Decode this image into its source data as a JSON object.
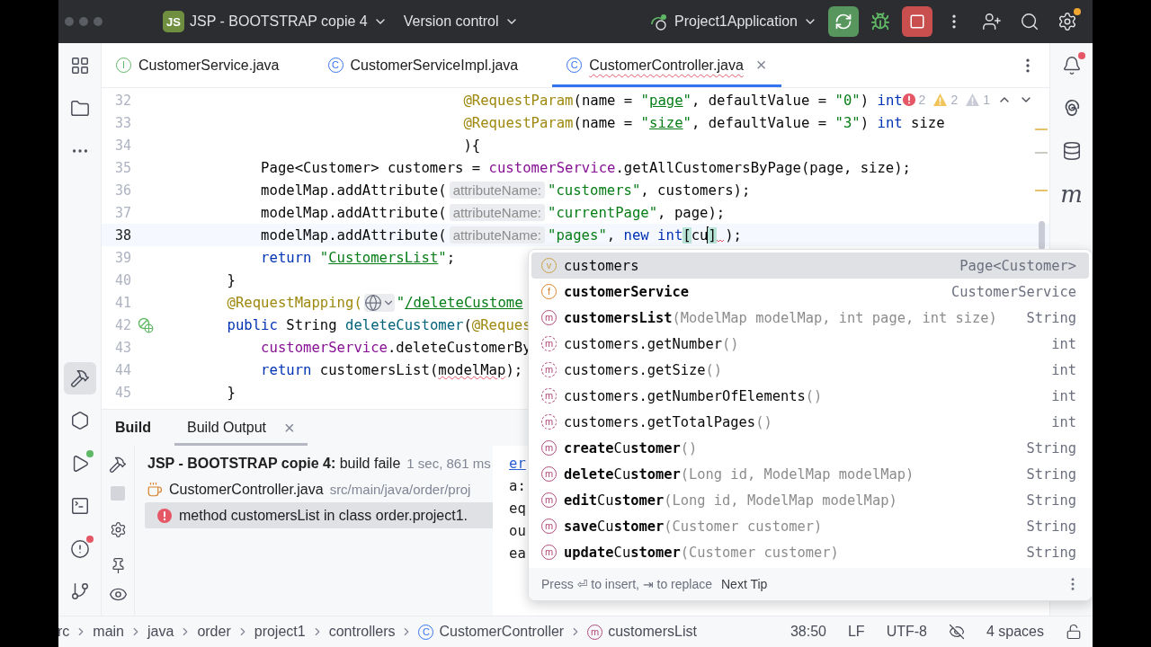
{
  "window": {
    "project_badge": "JS",
    "project": "JSP - BOOTSTRAP copie 4",
    "vcs": "Version control",
    "run_config": "Project1Application",
    "settings_has_badge": true
  },
  "left_tools_top": [
    {
      "kind": "structure",
      "selected": false
    },
    {
      "kind": "project",
      "selected": false
    },
    {
      "kind": "more",
      "selected": false
    }
  ],
  "left_tools_bottom": [
    {
      "kind": "build",
      "selected": true,
      "has_badge": false
    },
    {
      "kind": "services",
      "selected": false,
      "has_badge": false
    },
    {
      "kind": "run",
      "selected": false,
      "has_badge": true
    },
    {
      "kind": "terminal",
      "selected": false,
      "has_badge": false
    },
    {
      "kind": "problems",
      "selected": false,
      "has_badge": true
    },
    {
      "kind": "git",
      "selected": false,
      "has_badge": false
    }
  ],
  "right_tools": [
    {
      "kind": "notifications",
      "has_badge": true
    },
    {
      "kind": "ai"
    },
    {
      "kind": "database"
    },
    {
      "kind": "maven",
      "glyph": "m"
    }
  ],
  "tabs": [
    {
      "kind": "interface",
      "badge": "I",
      "label": "CustomerService.java",
      "selected": false,
      "has_errors": false
    },
    {
      "kind": "class",
      "badge": "C",
      "label": "CustomerServiceImpl.java",
      "selected": false,
      "has_errors": false
    },
    {
      "kind": "class",
      "badge": "C",
      "label": "CustomerController.java",
      "selected": true,
      "has_errors": true,
      "close": "×"
    }
  ],
  "inspections": {
    "errors": "2",
    "warnings": "2",
    "weak_warnings": "1"
  },
  "editor": {
    "lines": [
      {
        "number": "32",
        "current": false,
        "tokens": [
          {
            "kind": "ann",
            "text": "                                @RequestParam"
          },
          {
            "kind": "p",
            "text": "(name = "
          },
          {
            "kind": "str",
            "text": "\""
          },
          {
            "kind": "ustr",
            "text": "page"
          },
          {
            "kind": "str",
            "text": "\""
          },
          {
            "kind": "p",
            "text": ", defaultValue = "
          },
          {
            "kind": "str",
            "text": "\"0\""
          },
          {
            "kind": "p",
            "text": ") "
          },
          {
            "kind": "kw",
            "text": "int"
          }
        ]
      },
      {
        "number": "33",
        "current": false,
        "tokens": [
          {
            "kind": "ann",
            "text": "                                @RequestParam"
          },
          {
            "kind": "p",
            "text": "(name = "
          },
          {
            "kind": "str",
            "text": "\""
          },
          {
            "kind": "ustr",
            "text": "size"
          },
          {
            "kind": "str",
            "text": "\""
          },
          {
            "kind": "p",
            "text": ", defaultValue = "
          },
          {
            "kind": "str",
            "text": "\"3\""
          },
          {
            "kind": "p",
            "text": ") "
          },
          {
            "kind": "kw",
            "text": "int"
          },
          {
            "kind": "p",
            "text": " size"
          }
        ]
      },
      {
        "number": "34",
        "current": false,
        "tokens": [
          {
            "kind": "p",
            "text": "                                ){"
          }
        ]
      },
      {
        "number": "35",
        "current": false,
        "tokens": [
          {
            "kind": "p",
            "text": "        Page<Customer> customers = "
          },
          {
            "kind": "fld",
            "text": "customerService"
          },
          {
            "kind": "p",
            "text": ".getAllCustomersByPage(page, size);"
          }
        ]
      },
      {
        "number": "36",
        "current": false,
        "tokens": [
          {
            "kind": "p",
            "text": "        modelMap.addAttribute("
          },
          {
            "kind": "hint",
            "text": "attributeName:"
          },
          {
            "kind": "str",
            "text": "\"customers\""
          },
          {
            "kind": "p",
            "text": ", customers);"
          }
        ]
      },
      {
        "number": "37",
        "current": false,
        "tokens": [
          {
            "kind": "p",
            "text": "        modelMap.addAttribute("
          },
          {
            "kind": "hint",
            "text": "attributeName:"
          },
          {
            "kind": "str",
            "text": "\"currentPage\""
          },
          {
            "kind": "p",
            "text": ", page);"
          }
        ]
      },
      {
        "number": "38",
        "current": true,
        "tokens": [
          {
            "kind": "p",
            "text": "        modelMap.addAttribute("
          },
          {
            "kind": "hint",
            "text": "attributeName:"
          },
          {
            "kind": "str",
            "text": "\"pages\""
          },
          {
            "kind": "p",
            "text": ", "
          },
          {
            "kind": "kw",
            "text": "new int"
          },
          {
            "kind": "brk",
            "text": "["
          },
          {
            "kind": "p",
            "text": "cu"
          },
          {
            "kind": "caret"
          },
          {
            "kind": "brk",
            "text": "]"
          },
          {
            "kind": "squiggle"
          },
          {
            "kind": "p",
            "text": ");"
          }
        ]
      },
      {
        "number": "39",
        "current": false,
        "tokens": [
          {
            "kind": "kw",
            "text": "        return"
          },
          {
            "kind": "str",
            "text": " \""
          },
          {
            "kind": "ustr",
            "text": "CustomersList"
          },
          {
            "kind": "str",
            "text": "\""
          },
          {
            "kind": "p",
            "text": ";"
          }
        ]
      },
      {
        "number": "40",
        "current": false,
        "tokens": [
          {
            "kind": "p",
            "text": "    }"
          }
        ]
      },
      {
        "number": "41",
        "current": false,
        "tokens": [
          {
            "kind": "ann",
            "text": "    @RequestMapping("
          },
          {
            "kind": "globe"
          },
          {
            "kind": "str",
            "text": "\""
          },
          {
            "kind": "ustr",
            "text": "/deleteCustome"
          }
        ]
      },
      {
        "number": "42",
        "current": false,
        "endpoint_marker": true,
        "tokens": [
          {
            "kind": "kw",
            "text": "    public"
          },
          {
            "kind": "p",
            "text": " String "
          },
          {
            "kind": "decl",
            "text": "deleteCustomer"
          },
          {
            "kind": "p",
            "text": "("
          },
          {
            "kind": "ann",
            "text": "@Reques"
          }
        ]
      },
      {
        "number": "43",
        "current": false,
        "tokens": [
          {
            "kind": "fld",
            "text": "        customerService"
          },
          {
            "kind": "p",
            "text": ".deleteCustomerBy"
          }
        ]
      },
      {
        "number": "44",
        "current": false,
        "tokens": [
          {
            "kind": "kw",
            "text": "        return"
          },
          {
            "kind": "p",
            "text": " customersList("
          },
          {
            "kind": "err",
            "text": "modelMap"
          },
          {
            "kind": "p",
            "text": ");"
          }
        ]
      },
      {
        "number": "45",
        "current": false,
        "tokens": [
          {
            "kind": "p",
            "text": "    }"
          }
        ]
      }
    ]
  },
  "completion": {
    "items": [
      {
        "kind": "variable",
        "badge": "v",
        "name": "customers",
        "bold": false,
        "type": "Page<Customer>",
        "selected": true
      },
      {
        "kind": "field",
        "badge": "f",
        "name": "customerService",
        "bold": true,
        "type": "CustomerService",
        "selected": false
      },
      {
        "kind": "method",
        "badge": "m",
        "name": "customersList",
        "bold": true,
        "params": "(ModelMap modelMap, int page, int size)",
        "type": "String",
        "selected": false
      },
      {
        "kind": "inherited",
        "badge": "m",
        "name": "customers.getNumber",
        "bold": false,
        "params": "()",
        "type": "int",
        "selected": false
      },
      {
        "kind": "inherited",
        "badge": "m",
        "name": "customers.getSize",
        "bold": false,
        "params": "()",
        "type": "int",
        "selected": false
      },
      {
        "kind": "inherited",
        "badge": "m",
        "name": "customers.getNumberOfElements",
        "bold": false,
        "params": "()",
        "type": "int",
        "selected": false
      },
      {
        "kind": "inherited",
        "badge": "m",
        "name": "customers.getTotalPages",
        "bold": false,
        "params": "()",
        "type": "int",
        "selected": false
      },
      {
        "kind": "method",
        "badge": "m",
        "name": "**create**Cu**stomer**",
        "bold": false,
        "params": "()",
        "type": "String",
        "selected": false
      },
      {
        "kind": "method",
        "badge": "m",
        "name": "**delete**Cu**stomer**",
        "bold": false,
        "params": "(Long id, ModelMap modelMap)",
        "type": "String",
        "selected": false
      },
      {
        "kind": "method",
        "badge": "m",
        "name": "**edit**Cu**stomer**",
        "bold": false,
        "params": "(Long id, ModelMap modelMap)",
        "type": "String",
        "selected": false
      },
      {
        "kind": "method",
        "badge": "m",
        "name": "**save**Cu**stomer**",
        "bold": false,
        "params": "(Customer customer)",
        "type": "String",
        "selected": false
      },
      {
        "kind": "method",
        "badge": "m",
        "name": "**update**Cu**stomer**",
        "bold": false,
        "params": "(Customer customer)",
        "type": "String",
        "selected": false
      }
    ],
    "hint": "Press ⏎ to insert, ⇥ to replace",
    "tip": "Next Tip"
  },
  "build": {
    "title": "Build",
    "tabs": [
      {
        "label": "Build Output",
        "selected": true,
        "close": "×"
      }
    ],
    "tree": [
      {
        "text": "**JSP - BOOTSTRAP copie 4:** build faile",
        "meta": "1 sec, 861 ms",
        "selected": false,
        "children": [
          {
            "kind": "file",
            "text": "CustomerController.java",
            "meta": "src/main/java/order/proj",
            "selected": false,
            "children": [
              {
                "kind": "error",
                "text": "method customersList in class order.project1.",
                "selected": true
              }
            ]
          }
        ]
      }
    ],
    "console": [
      {
        "text": "er",
        "link": true
      },
      {
        "text": "a:",
        "link": false
      },
      {
        "text": "eq",
        "link": false
      },
      {
        "text": "ou",
        "link": false
      },
      {
        "text": "ea",
        "link": false
      }
    ]
  },
  "status_bar": {
    "breadcrumbs": [
      {
        "label": "rc"
      },
      {
        "label": "main"
      },
      {
        "label": "java"
      },
      {
        "label": "order"
      },
      {
        "label": "project1"
      },
      {
        "label": "controllers"
      },
      {
        "label": "CustomerController",
        "kind": "class",
        "badge": "C"
      },
      {
        "label": "customersList",
        "kind": "method",
        "badge": "m"
      }
    ],
    "position": "38:50",
    "line_separator": "LF",
    "encoding": "UTF-8",
    "indent": "4 spaces"
  }
}
